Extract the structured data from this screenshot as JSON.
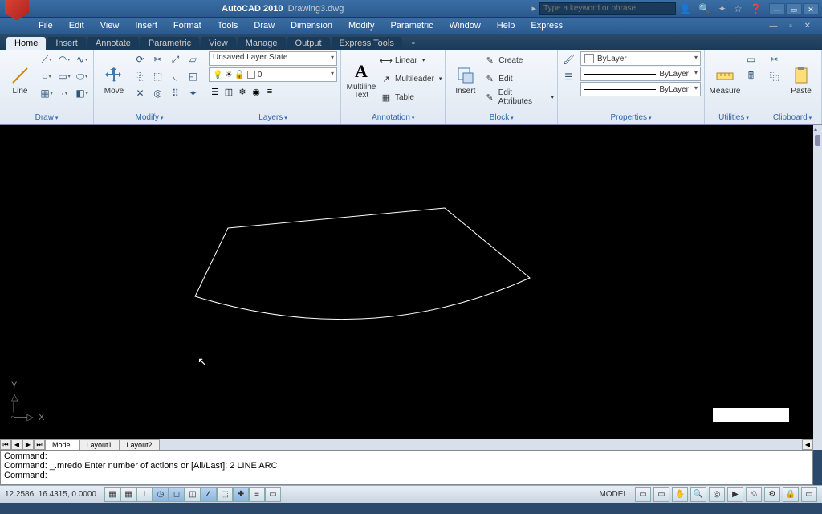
{
  "title": {
    "app": "AutoCAD 2010",
    "file": "Drawing3.dwg"
  },
  "search": {
    "placeholder": "Type a keyword or phrase"
  },
  "menubar": [
    "File",
    "Edit",
    "View",
    "Insert",
    "Format",
    "Tools",
    "Draw",
    "Dimension",
    "Modify",
    "Parametric",
    "Window",
    "Help",
    "Express"
  ],
  "tabs": [
    "Home",
    "Insert",
    "Annotate",
    "Parametric",
    "View",
    "Manage",
    "Output",
    "Express Tools"
  ],
  "ribbon": {
    "draw": {
      "title": "Draw",
      "line": "Line"
    },
    "modify": {
      "title": "Modify",
      "move": "Move"
    },
    "layers": {
      "title": "Layers",
      "state": "Unsaved Layer State",
      "current": "0"
    },
    "annotation": {
      "title": "Annotation",
      "mtext": "Multiline\nText",
      "linear": "Linear",
      "mleader": "Multileader",
      "table": "Table"
    },
    "block": {
      "title": "Block",
      "insert": "Insert",
      "create": "Create",
      "edit": "Edit",
      "editattr": "Edit Attributes"
    },
    "properties": {
      "title": "Properties",
      "bylayer1": "ByLayer",
      "bylayer2": "ByLayer",
      "bylayer3": "ByLayer"
    },
    "utilities": {
      "title": "Utilities",
      "measure": "Measure"
    },
    "clipboard": {
      "title": "Clipboard",
      "paste": "Paste"
    }
  },
  "layout_tabs": [
    "Model",
    "Layout1",
    "Layout2"
  ],
  "command": {
    "line1": "Command:",
    "line2": "Command: _.mredo Enter number of actions or [All/Last]: 2 LINE ARC",
    "line3": "Command:"
  },
  "status": {
    "coords": "12.2586, 16.4315, 0.0000",
    "model": "MODEL"
  }
}
